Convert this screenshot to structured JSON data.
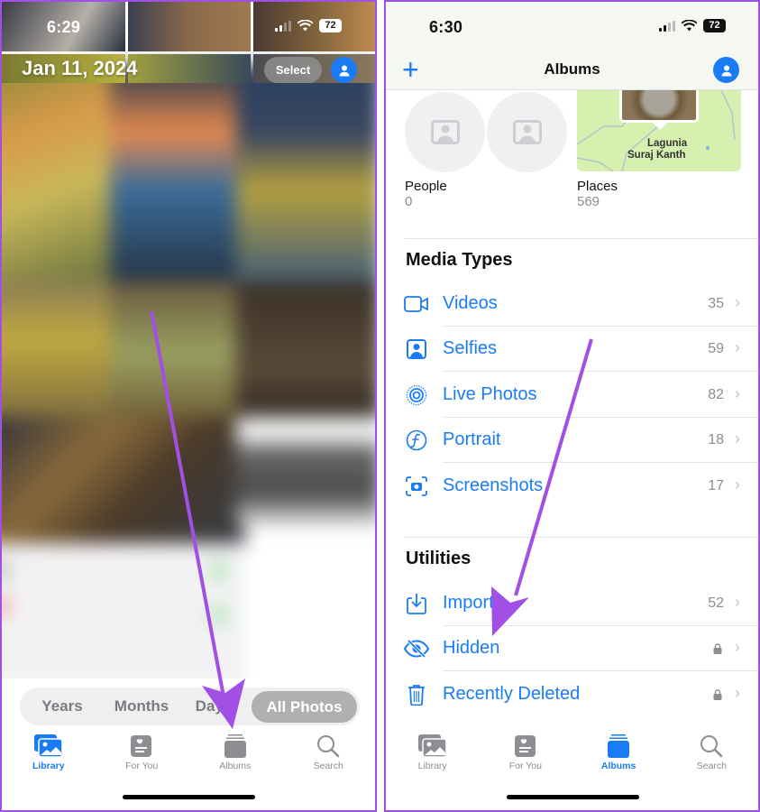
{
  "left_screen": {
    "status_bar": {
      "time": "6:29",
      "battery": "72"
    },
    "header": {
      "date": "Jan 11, 2024",
      "select_label": "Select"
    },
    "view_switcher": {
      "options": [
        "Years",
        "Months",
        "Days",
        "All Photos"
      ],
      "selected": "All Photos"
    },
    "tab_bar": {
      "tabs": [
        {
          "label": "Library",
          "icon": "library-icon",
          "active": true
        },
        {
          "label": "For You",
          "icon": "for-you-icon",
          "active": false
        },
        {
          "label": "Albums",
          "icon": "albums-icon",
          "active": false
        },
        {
          "label": "Search",
          "icon": "search-icon",
          "active": false
        }
      ]
    }
  },
  "right_screen": {
    "status_bar": {
      "time": "6:30",
      "battery": "72"
    },
    "header": {
      "title": "Albums",
      "add_icon": "plus-icon"
    },
    "people": {
      "label": "People",
      "count": "0"
    },
    "places": {
      "label": "Places",
      "count": "569",
      "map_labels": [
        "Lagunia",
        "Suraj Kanth"
      ]
    },
    "media_types": {
      "title": "Media Types",
      "items": [
        {
          "label": "Videos",
          "count": "35",
          "icon": "video-icon"
        },
        {
          "label": "Selfies",
          "count": "59",
          "icon": "selfie-icon"
        },
        {
          "label": "Live Photos",
          "count": "82",
          "icon": "live-photo-icon"
        },
        {
          "label": "Portrait",
          "count": "18",
          "icon": "portrait-icon"
        },
        {
          "label": "Screenshots",
          "count": "17",
          "icon": "screenshot-icon"
        }
      ]
    },
    "utilities": {
      "title": "Utilities",
      "items": [
        {
          "label": "Imports",
          "count": "52",
          "icon": "import-icon",
          "locked": false
        },
        {
          "label": "Hidden",
          "count": "",
          "icon": "hidden-eye-icon",
          "locked": true
        },
        {
          "label": "Recently Deleted",
          "count": "",
          "icon": "trash-icon",
          "locked": true
        }
      ]
    },
    "tab_bar": {
      "tabs": [
        {
          "label": "Library",
          "icon": "library-icon",
          "active": false
        },
        {
          "label": "For You",
          "icon": "for-you-icon",
          "active": false
        },
        {
          "label": "Albums",
          "icon": "albums-icon",
          "active": true
        },
        {
          "label": "Search",
          "icon": "search-icon",
          "active": false
        }
      ]
    }
  },
  "colors": {
    "accent": "#1a7cf5",
    "annotation_arrow": "#a24fe6",
    "secondary_text": "#8d8d92"
  }
}
